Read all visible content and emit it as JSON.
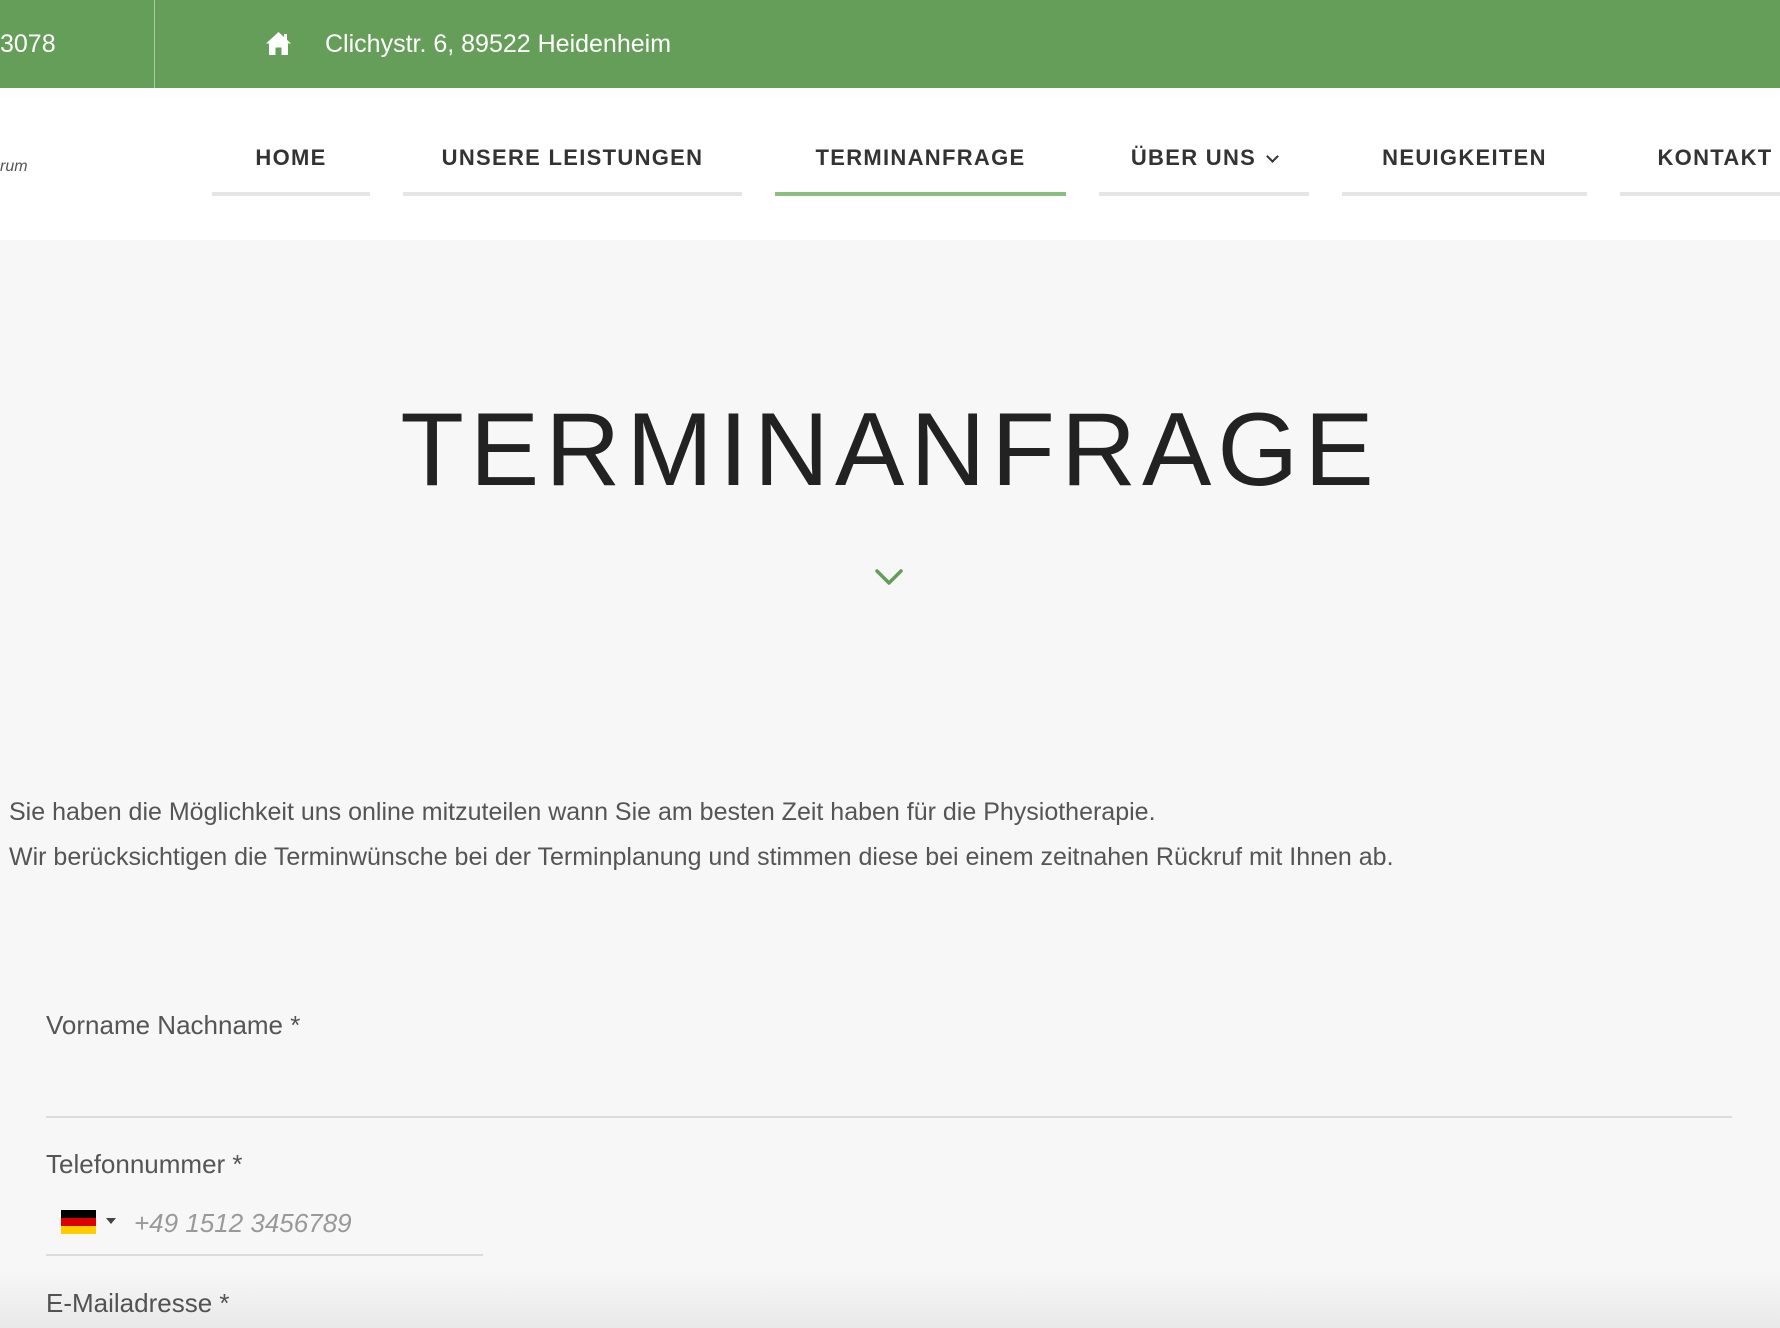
{
  "topbar": {
    "phone": "3078",
    "address": "Clichystr. 6, 89522 Heidenheim"
  },
  "logo_fragment": "rum",
  "nav": {
    "home": "HOME",
    "services": "UNSERE LEISTUNGEN",
    "appointment": "TERMINANFRAGE",
    "about": "ÜBER UNS",
    "news": "NEUIGKEITEN",
    "contact": "KONTAKT"
  },
  "page": {
    "title": "TERMINANFRAGE",
    "intro_line_1": "Sie haben die Möglichkeit uns online mitzuteilen wann Sie am besten Zeit haben für die Physiotherapie.",
    "intro_line_2": "Wir berücksichtigen die Terminwünsche bei der Terminplanung und stimmen diese bei einem zeitnahen Rückruf mit Ihnen ab."
  },
  "form": {
    "name_label": "Vorname Nachname *",
    "name_value": "",
    "phone_label": "Telefonnummer *",
    "phone_placeholder": "+49 1512 3456789",
    "email_label": "E-Mailadresse *"
  },
  "colors": {
    "brand_green": "#659e58",
    "active_underline": "#8bbf7f",
    "flag_black": "#000000",
    "flag_red": "#dd0000",
    "flag_gold": "#ffce00"
  },
  "icons": {
    "topbar_home": "home-icon",
    "title_chevron": "chevron-down-icon",
    "country_flag": "germany-flag-icon"
  }
}
